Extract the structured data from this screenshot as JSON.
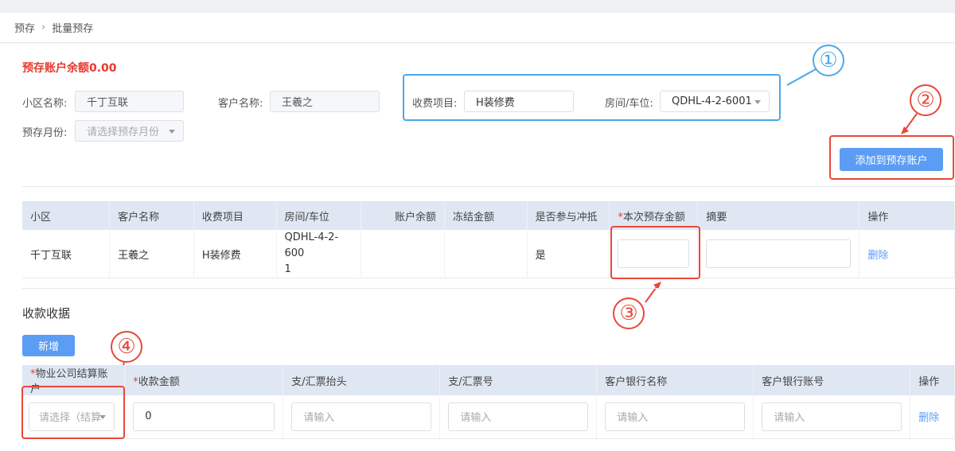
{
  "breadcrumb": {
    "parent": "预存",
    "current": "批量预存"
  },
  "balance": "预存账户余额0.00",
  "form": {
    "community_label": "小区名称:",
    "community_value": "千丁互联",
    "customer_label": "客户名称:",
    "customer_value": "王羲之",
    "month_label": "预存月份:",
    "month_placeholder": "请选择预存月份",
    "fee_label": "收费项目:",
    "fee_value": "H装修费",
    "room_label": "房间/车位:",
    "room_value": "QDHL-4-2-6001"
  },
  "add_button": "添加到预存账户",
  "table1": {
    "headers": [
      "小区",
      "客户名称",
      "收费项目",
      "房间/车位",
      "账户余额",
      "冻结金额",
      "是否参与冲抵",
      "本次预存金额",
      "摘要",
      "操作"
    ],
    "required_mark": "*",
    "row": {
      "community": "千丁互联",
      "customer": "王羲之",
      "fee": "H装修费",
      "room_line1": "QDHL-4-2-600",
      "room_line2": "1",
      "balance": "",
      "frozen": "",
      "offset": "是",
      "action": "删除"
    }
  },
  "receipt": {
    "title": "收款收据",
    "add_button": "新增",
    "headers": [
      "物业公司结算账户",
      "收款金额",
      "支/汇票抬头",
      "支/汇票号",
      "客户银行名称",
      "客户银行账号",
      "操作"
    ],
    "row": {
      "account_placeholder": "请选择（结算",
      "amount": "0",
      "placeholder": "请输入",
      "action": "删除"
    }
  },
  "annotations": {
    "n1": "①",
    "n2": "②",
    "n3": "③",
    "n4": "④"
  },
  "colors": {
    "primary": "#5b9cf5",
    "red": "#e63a2e",
    "annotation_red": "#e8483a",
    "annotation_blue": "#4aa8e8"
  }
}
